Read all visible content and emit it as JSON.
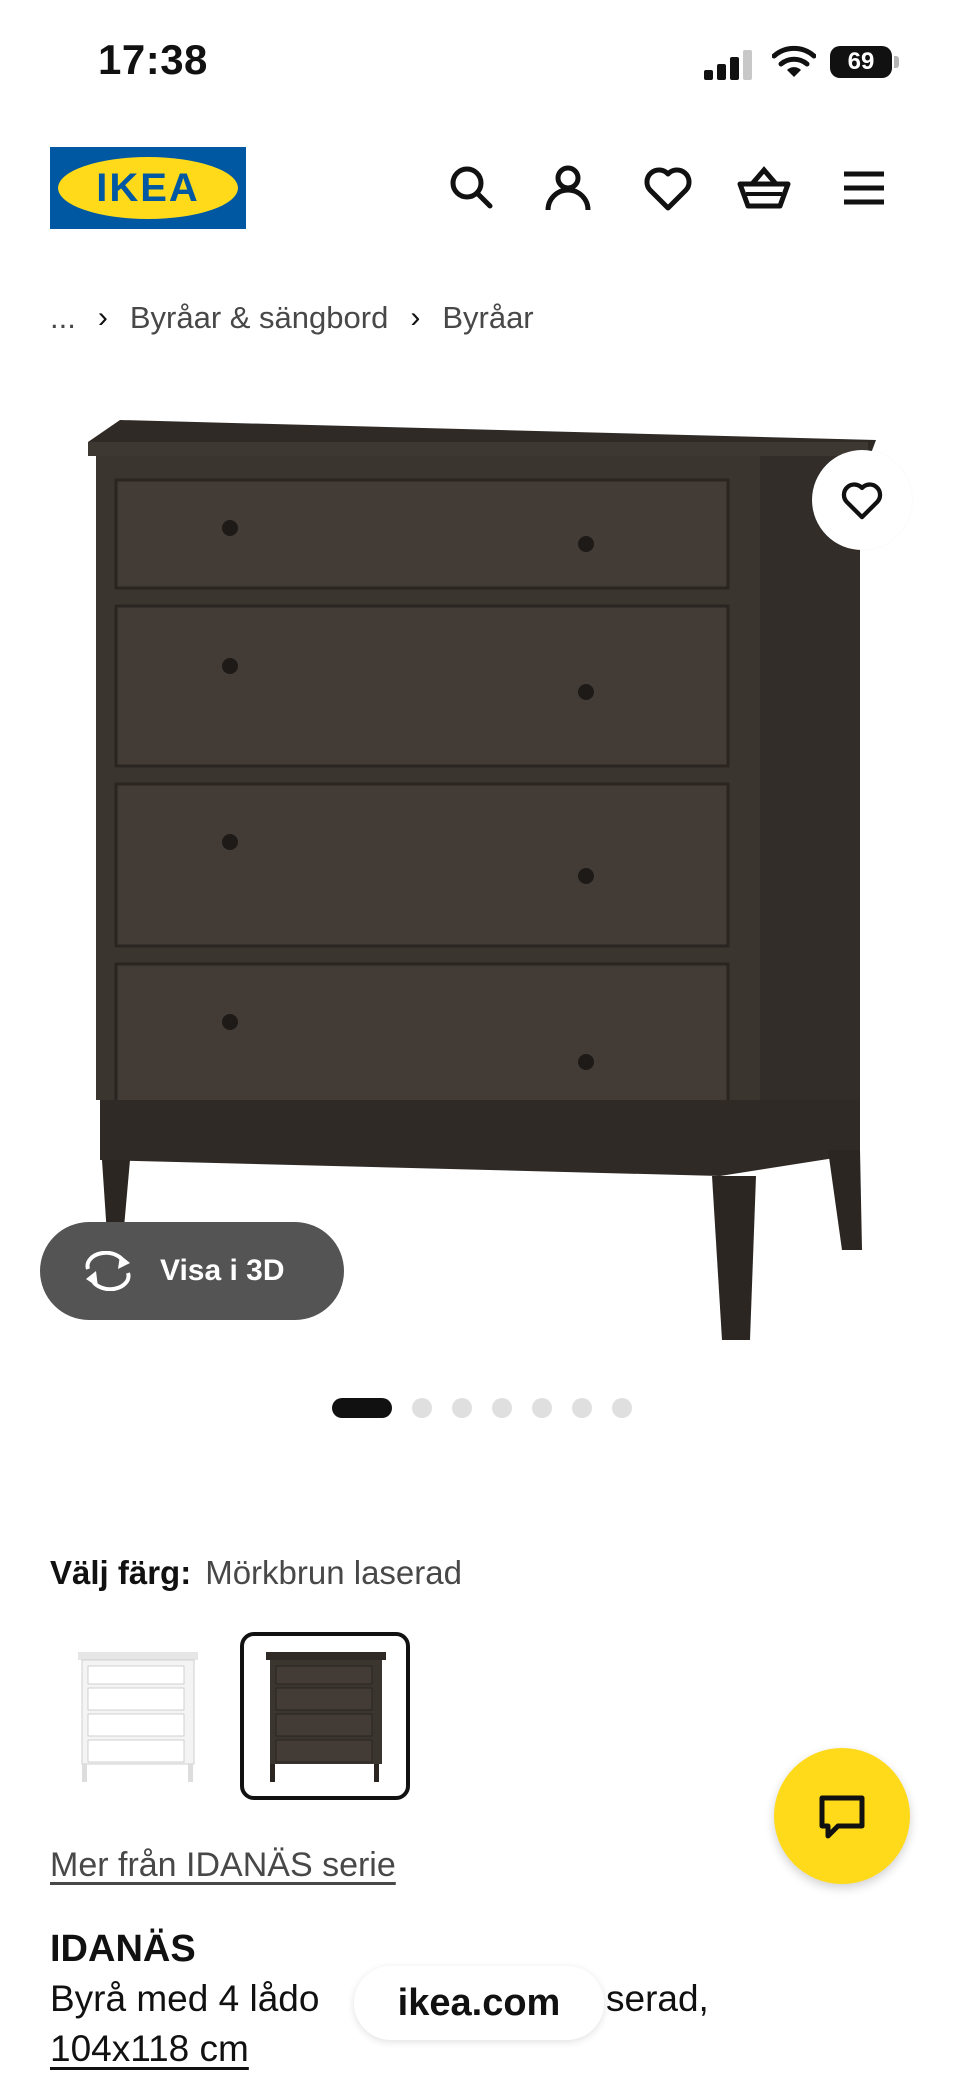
{
  "status_bar": {
    "time": "17:38",
    "battery": "69"
  },
  "header": {
    "logo_text": "IKEA",
    "icons": [
      "search-icon",
      "account-icon",
      "heart-icon",
      "basket-icon",
      "menu-icon"
    ]
  },
  "breadcrumb": {
    "ellipsis": "...",
    "items": [
      "Byråar & sängbord",
      "Byråar"
    ]
  },
  "gallery": {
    "view_3d_label": "Visa i 3D",
    "total_images": 7,
    "active_index": 0
  },
  "color": {
    "label": "Välj färg:",
    "selected": "Mörkbrun laserad",
    "options": [
      "white",
      "dark-brown"
    ]
  },
  "series_link": "Mer från IDANÄS serie",
  "product": {
    "name": "IDANÄS",
    "desc_start": "Byrå med 4 lådo",
    "desc_end": "serad,",
    "size": "104x118 cm"
  },
  "browser": {
    "url": "ikea.com"
  },
  "colors": {
    "ikea_blue": "#0058a3",
    "ikea_yellow": "#ffda1a",
    "wood": "#3b3530"
  }
}
